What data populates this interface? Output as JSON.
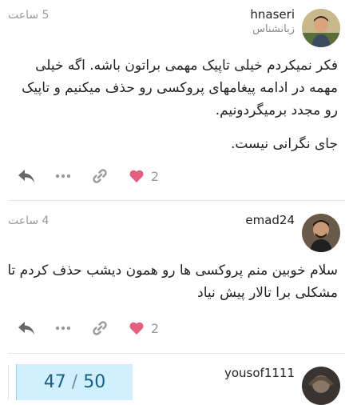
{
  "posts": [
    {
      "username": "hnaseri",
      "user_title": "زبانشناس",
      "time": "5 ساعت",
      "paragraphs": [
        "فکر نمیکردم خیلی تاپیک مهمی براتون باشه. اگه خیلی مهمه در ادامه پیغامهای پروکسی رو حذف میکنیم و تاپیک رو مجدد برمیگردونیم.",
        "جای نگرانی نیست."
      ],
      "like_count": "2"
    },
    {
      "username": "emad24",
      "time": "4 ساعت",
      "paragraphs": [
        "سلام خوبین منم پروکسی ها رو همون دیشب حذف کردم تا مشکلی برا تالار پیش نیاد"
      ],
      "like_count": "2"
    },
    {
      "username": "yousof1111"
    }
  ],
  "progress": {
    "current": "47",
    "separator": "/",
    "total": "50"
  },
  "colors": {
    "like_heart": "#e45f7e",
    "progress_bg": "#d1f0ff",
    "progress_text": "#1a5f86"
  }
}
